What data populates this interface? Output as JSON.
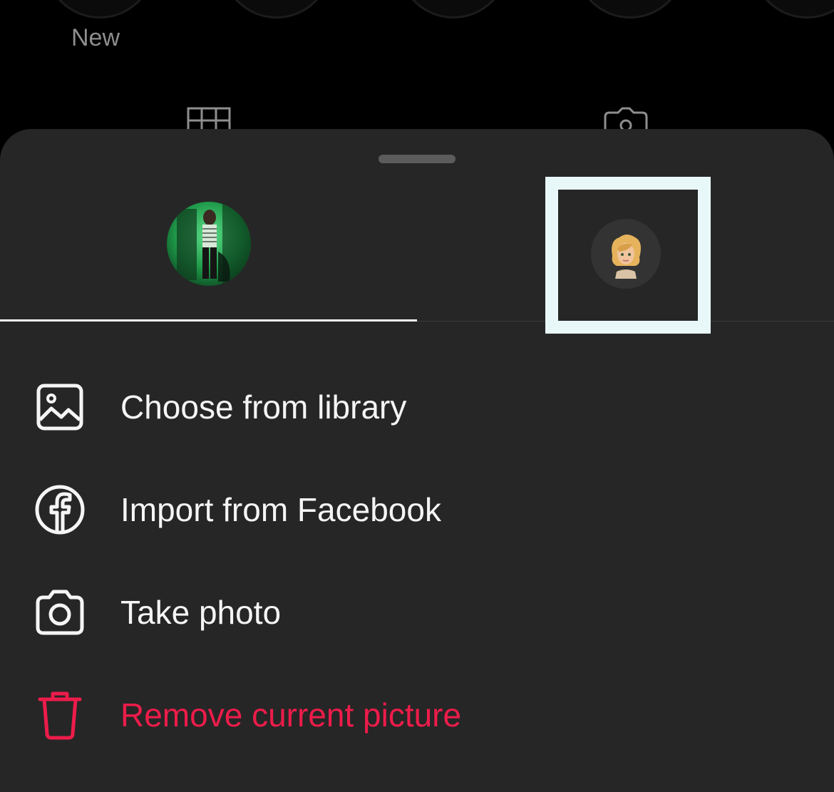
{
  "background": {
    "highlights": {
      "new_label": "New"
    }
  },
  "sheet": {
    "tabs": [
      {
        "name": "profile-photo-tab",
        "active": true
      },
      {
        "name": "avatar-tab",
        "active": false
      }
    ],
    "menu": [
      {
        "label": "Choose from library",
        "icon": "image-icon"
      },
      {
        "label": "Import from Facebook",
        "icon": "facebook-icon"
      },
      {
        "label": "Take photo",
        "icon": "camera-icon"
      },
      {
        "label": "Remove current picture",
        "icon": "trash-icon",
        "destructive": true
      }
    ]
  },
  "colors": {
    "background": "#000000",
    "sheet": "#262626",
    "text": "#f5f5f5",
    "destructive": "#ed1c4a",
    "selection_frame": "#e8f8f8"
  }
}
